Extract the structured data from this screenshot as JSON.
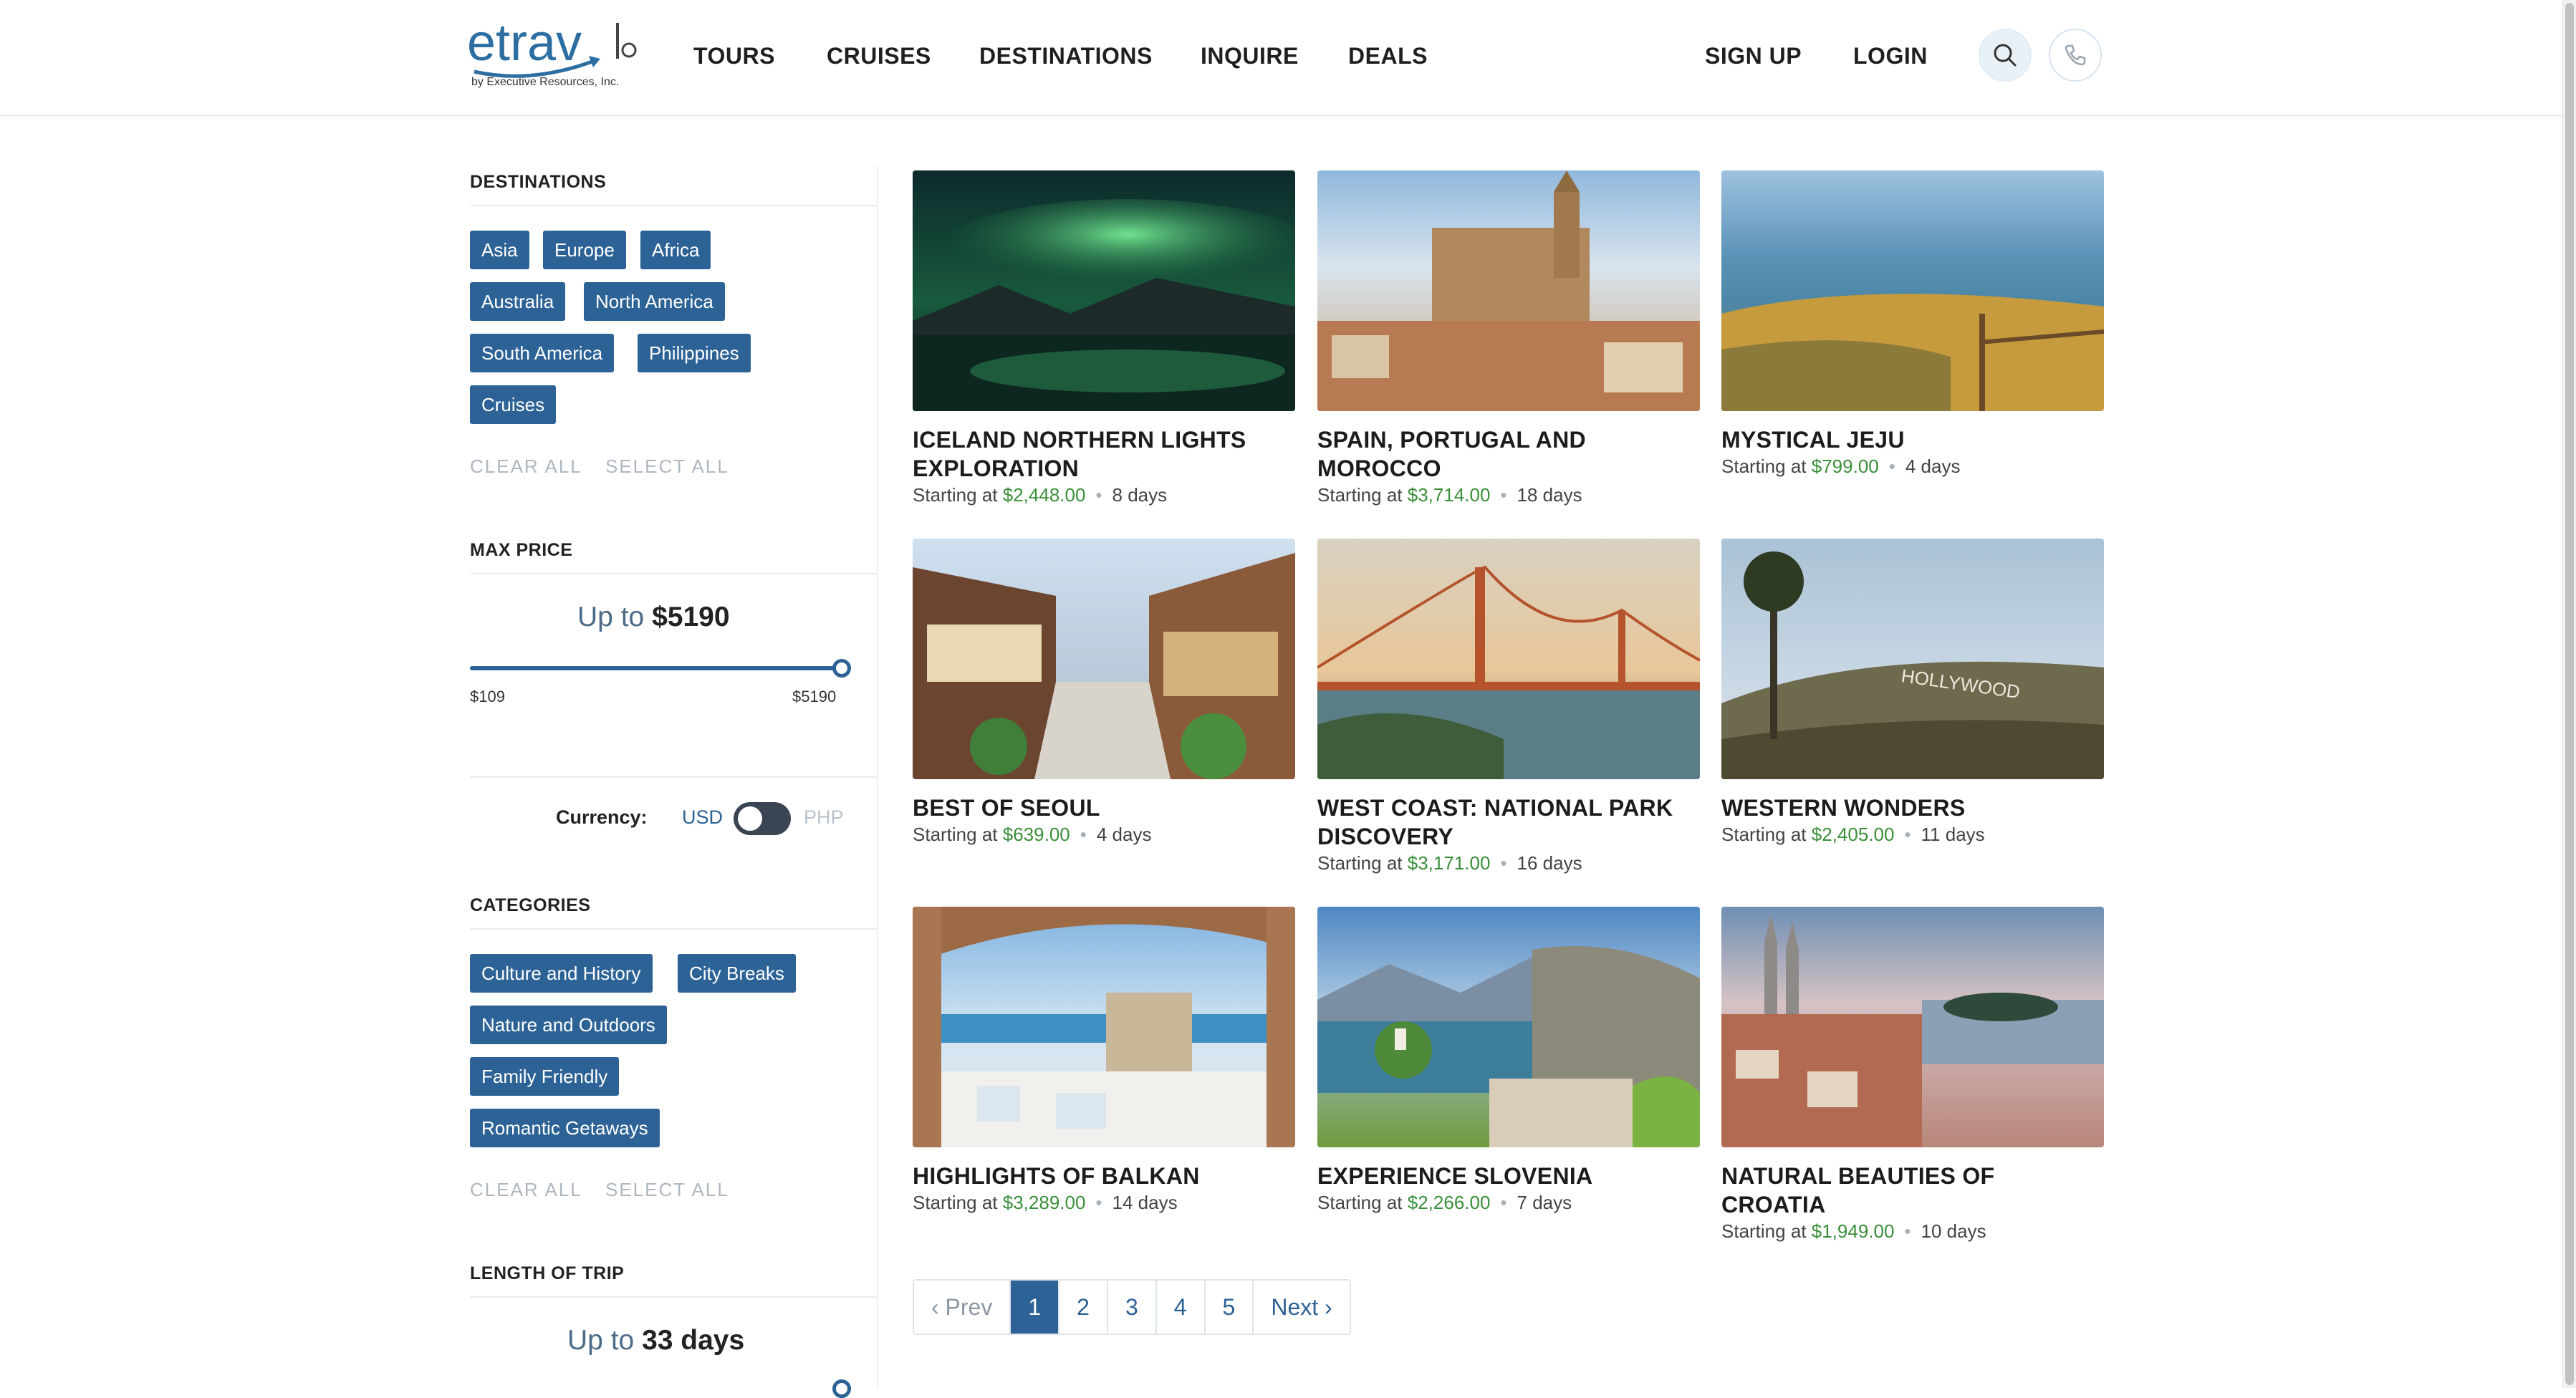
{
  "brand": {
    "name": "etrav",
    "sub": "by Executive Resources, Inc."
  },
  "nav": {
    "items": [
      "TOURS",
      "CRUISES",
      "DESTINATIONS",
      "INQUIRE",
      "DEALS"
    ],
    "signup": "SIGN UP",
    "login": "LOGIN",
    "search_icon": "search-icon",
    "phone_icon": "phone-icon"
  },
  "sidebar": {
    "destinations": {
      "heading": "DESTINATIONS",
      "tags": [
        "Asia",
        "Europe",
        "Africa",
        "Australia",
        "North America",
        "South America",
        "Philippines",
        "Cruises"
      ],
      "clear": "CLEAR ALL",
      "select": "SELECT ALL"
    },
    "max_price": {
      "heading": "MAX PRICE",
      "up_to": "Up to",
      "value": "$5190",
      "min": "$109",
      "max": "$5190",
      "slider_fraction": 1.0
    },
    "currency": {
      "label": "Currency:",
      "usd": "USD",
      "php": "PHP",
      "selected": "USD"
    },
    "categories": {
      "heading": "CATEGORIES",
      "tags": [
        "Culture and History",
        "City Breaks",
        "Nature and Outdoors",
        "Family Friendly",
        "Romantic Getaways"
      ],
      "clear": "CLEAR ALL",
      "select": "SELECT ALL"
    },
    "length": {
      "heading": "LENGTH OF TRIP",
      "up_to": "Up to",
      "value": "33 days"
    }
  },
  "tours": [
    {
      "title": "ICELAND NORTHERN LIGHTS EXPLORATION",
      "starting": "Starting at",
      "price": "$2,448.00",
      "days": "8 days"
    },
    {
      "title": "SPAIN, PORTUGAL AND MOROCCO",
      "starting": "Starting at",
      "price": "$3,714.00",
      "days": "18 days"
    },
    {
      "title": "MYSTICAL JEJU",
      "starting": "Starting at",
      "price": "$799.00",
      "days": "4 days"
    },
    {
      "title": "BEST OF SEOUL",
      "starting": "Starting at",
      "price": "$639.00",
      "days": "4 days"
    },
    {
      "title": "WEST COAST: NATIONAL PARK DISCOVERY",
      "starting": "Starting at",
      "price": "$3,171.00",
      "days": "16 days"
    },
    {
      "title": "WESTERN WONDERS",
      "starting": "Starting at",
      "price": "$2,405.00",
      "days": "11 days"
    },
    {
      "title": "HIGHLIGHTS OF BALKAN",
      "starting": "Starting at",
      "price": "$3,289.00",
      "days": "14 days"
    },
    {
      "title": "EXPERIENCE SLOVENIA",
      "starting": "Starting at",
      "price": "$2,266.00",
      "days": "7 days"
    },
    {
      "title": "NATURAL BEAUTIES OF CROATIA",
      "starting": "Starting at",
      "price": "$1,949.00",
      "days": "10 days"
    }
  ],
  "pagination": {
    "prev": "‹ Prev",
    "pages": [
      "1",
      "2",
      "3",
      "4",
      "5"
    ],
    "active": "1",
    "next": "Next ›"
  },
  "colors": {
    "accent": "#2c6295",
    "price": "#3a8f3a",
    "muted": "#aeb7c0"
  }
}
